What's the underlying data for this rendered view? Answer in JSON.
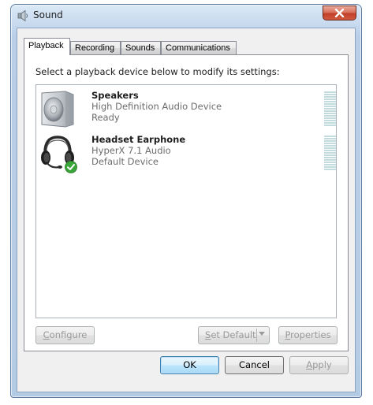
{
  "window": {
    "title": "Sound",
    "icon": "speaker-icon",
    "close_icon": "close-icon"
  },
  "tabs": [
    {
      "label": "Playback",
      "active": true
    },
    {
      "label": "Recording",
      "active": false
    },
    {
      "label": "Sounds",
      "active": false
    },
    {
      "label": "Communications",
      "active": false
    }
  ],
  "playback": {
    "instruction": "Select a playback device below to modify its settings:",
    "devices": [
      {
        "name": "Speakers",
        "description": "High Definition Audio Device",
        "status": "Ready",
        "icon": "speaker-device-icon",
        "is_default": false
      },
      {
        "name": "Headset Earphone",
        "description": "HyperX 7.1 Audio",
        "status": "Default Device",
        "icon": "headset-device-icon",
        "is_default": true,
        "badge_icon": "green-checkmark-icon"
      }
    ],
    "buttons": {
      "configure": {
        "label": "Configure",
        "hotkey": "C",
        "rest": "onfigure",
        "enabled": false
      },
      "set_default": {
        "label": "Set Default",
        "hotkey": "S",
        "rest": "et Default",
        "enabled": false
      },
      "properties": {
        "label": "Properties",
        "hotkey": "P",
        "rest": "roperties",
        "enabled": false
      }
    }
  },
  "dialog_buttons": {
    "ok": {
      "label": "OK",
      "enabled": true
    },
    "cancel": {
      "label": "Cancel",
      "enabled": true
    },
    "apply": {
      "label": "Apply",
      "hotkey": "A",
      "rest": "pply",
      "enabled": false
    }
  },
  "colors": {
    "frame": "#b4cbe4",
    "close_button": "#c2402a",
    "meter": "#c3dcdf",
    "default_check": "#3aa53a"
  }
}
